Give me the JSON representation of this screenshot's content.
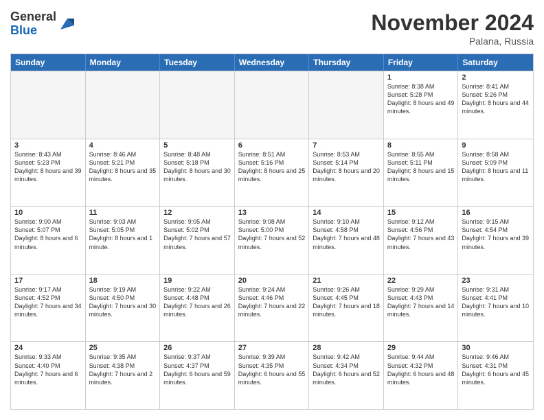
{
  "logo": {
    "general": "General",
    "blue": "Blue"
  },
  "header": {
    "month": "November 2024",
    "location": "Palana, Russia"
  },
  "weekdays": [
    "Sunday",
    "Monday",
    "Tuesday",
    "Wednesday",
    "Thursday",
    "Friday",
    "Saturday"
  ],
  "rows": [
    [
      {
        "day": "",
        "empty": true
      },
      {
        "day": "",
        "empty": true
      },
      {
        "day": "",
        "empty": true
      },
      {
        "day": "",
        "empty": true
      },
      {
        "day": "",
        "empty": true
      },
      {
        "day": "1",
        "sunrise": "8:38 AM",
        "sunset": "5:28 PM",
        "daylight": "8 hours and 49 minutes."
      },
      {
        "day": "2",
        "sunrise": "8:41 AM",
        "sunset": "5:26 PM",
        "daylight": "8 hours and 44 minutes."
      }
    ],
    [
      {
        "day": "3",
        "sunrise": "8:43 AM",
        "sunset": "5:23 PM",
        "daylight": "8 hours and 39 minutes."
      },
      {
        "day": "4",
        "sunrise": "8:46 AM",
        "sunset": "5:21 PM",
        "daylight": "8 hours and 35 minutes."
      },
      {
        "day": "5",
        "sunrise": "8:48 AM",
        "sunset": "5:18 PM",
        "daylight": "8 hours and 30 minutes."
      },
      {
        "day": "6",
        "sunrise": "8:51 AM",
        "sunset": "5:16 PM",
        "daylight": "8 hours and 25 minutes."
      },
      {
        "day": "7",
        "sunrise": "8:53 AM",
        "sunset": "5:14 PM",
        "daylight": "8 hours and 20 minutes."
      },
      {
        "day": "8",
        "sunrise": "8:55 AM",
        "sunset": "5:11 PM",
        "daylight": "8 hours and 15 minutes."
      },
      {
        "day": "9",
        "sunrise": "8:58 AM",
        "sunset": "5:09 PM",
        "daylight": "8 hours and 11 minutes."
      }
    ],
    [
      {
        "day": "10",
        "sunrise": "9:00 AM",
        "sunset": "5:07 PM",
        "daylight": "8 hours and 6 minutes."
      },
      {
        "day": "11",
        "sunrise": "9:03 AM",
        "sunset": "5:05 PM",
        "daylight": "8 hours and 1 minute."
      },
      {
        "day": "12",
        "sunrise": "9:05 AM",
        "sunset": "5:02 PM",
        "daylight": "7 hours and 57 minutes."
      },
      {
        "day": "13",
        "sunrise": "9:08 AM",
        "sunset": "5:00 PM",
        "daylight": "7 hours and 52 minutes."
      },
      {
        "day": "14",
        "sunrise": "9:10 AM",
        "sunset": "4:58 PM",
        "daylight": "7 hours and 48 minutes."
      },
      {
        "day": "15",
        "sunrise": "9:12 AM",
        "sunset": "4:56 PM",
        "daylight": "7 hours and 43 minutes."
      },
      {
        "day": "16",
        "sunrise": "9:15 AM",
        "sunset": "4:54 PM",
        "daylight": "7 hours and 39 minutes."
      }
    ],
    [
      {
        "day": "17",
        "sunrise": "9:17 AM",
        "sunset": "4:52 PM",
        "daylight": "7 hours and 34 minutes."
      },
      {
        "day": "18",
        "sunrise": "9:19 AM",
        "sunset": "4:50 PM",
        "daylight": "7 hours and 30 minutes."
      },
      {
        "day": "19",
        "sunrise": "9:22 AM",
        "sunset": "4:48 PM",
        "daylight": "7 hours and 26 minutes."
      },
      {
        "day": "20",
        "sunrise": "9:24 AM",
        "sunset": "4:46 PM",
        "daylight": "7 hours and 22 minutes."
      },
      {
        "day": "21",
        "sunrise": "9:26 AM",
        "sunset": "4:45 PM",
        "daylight": "7 hours and 18 minutes."
      },
      {
        "day": "22",
        "sunrise": "9:29 AM",
        "sunset": "4:43 PM",
        "daylight": "7 hours and 14 minutes."
      },
      {
        "day": "23",
        "sunrise": "9:31 AM",
        "sunset": "4:41 PM",
        "daylight": "7 hours and 10 minutes."
      }
    ],
    [
      {
        "day": "24",
        "sunrise": "9:33 AM",
        "sunset": "4:40 PM",
        "daylight": "7 hours and 6 minutes."
      },
      {
        "day": "25",
        "sunrise": "9:35 AM",
        "sunset": "4:38 PM",
        "daylight": "7 hours and 2 minutes."
      },
      {
        "day": "26",
        "sunrise": "9:37 AM",
        "sunset": "4:37 PM",
        "daylight": "6 hours and 59 minutes."
      },
      {
        "day": "27",
        "sunrise": "9:39 AM",
        "sunset": "4:35 PM",
        "daylight": "6 hours and 55 minutes."
      },
      {
        "day": "28",
        "sunrise": "9:42 AM",
        "sunset": "4:34 PM",
        "daylight": "6 hours and 52 minutes."
      },
      {
        "day": "29",
        "sunrise": "9:44 AM",
        "sunset": "4:32 PM",
        "daylight": "6 hours and 48 minutes."
      },
      {
        "day": "30",
        "sunrise": "9:46 AM",
        "sunset": "4:31 PM",
        "daylight": "6 hours and 45 minutes."
      }
    ]
  ]
}
